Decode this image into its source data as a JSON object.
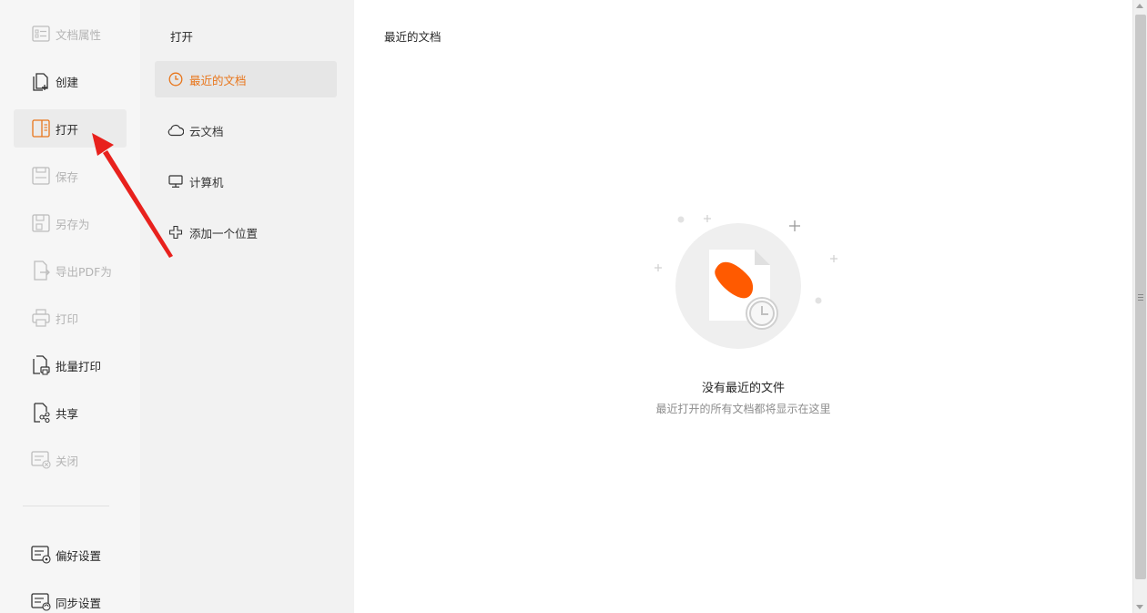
{
  "left_nav": {
    "items": [
      {
        "label": "文档属性",
        "icon": "document-properties-icon",
        "state": "disabled"
      },
      {
        "label": "创建",
        "icon": "create-document-icon",
        "state": "enabled"
      },
      {
        "label": "打开",
        "icon": "open-book-icon",
        "state": "active"
      },
      {
        "label": "保存",
        "icon": "save-icon",
        "state": "disabled"
      },
      {
        "label": "另存为",
        "icon": "save-as-icon",
        "state": "disabled"
      },
      {
        "label": "导出PDF为",
        "icon": "export-icon",
        "state": "disabled"
      },
      {
        "label": "打印",
        "icon": "print-icon",
        "state": "disabled"
      },
      {
        "label": "批量打印",
        "icon": "batch-print-icon",
        "state": "enabled"
      },
      {
        "label": "共享",
        "icon": "share-icon",
        "state": "enabled"
      },
      {
        "label": "关闭",
        "icon": "close-document-icon",
        "state": "disabled"
      }
    ],
    "bottom_items": [
      {
        "label": "偏好设置",
        "icon": "preferences-icon"
      },
      {
        "label": "同步设置",
        "icon": "sync-settings-icon"
      }
    ]
  },
  "open_panel": {
    "title": "打开",
    "locations": [
      {
        "label": "最近的文档",
        "icon": "clock-icon",
        "active": true
      },
      {
        "label": "云文档",
        "icon": "cloud-icon",
        "active": false
      },
      {
        "label": "计算机",
        "icon": "monitor-icon",
        "active": false
      },
      {
        "label": "添加一个位置",
        "icon": "plus-icon",
        "active": false
      }
    ]
  },
  "main": {
    "title": "最近的文档",
    "empty_title": "没有最近的文件",
    "empty_subtitle": "最近打开的所有文档都将显示在这里"
  },
  "colors": {
    "accent": "#e8751a",
    "brand_orange": "#ff5a00",
    "annotation_red": "#e8211d"
  }
}
